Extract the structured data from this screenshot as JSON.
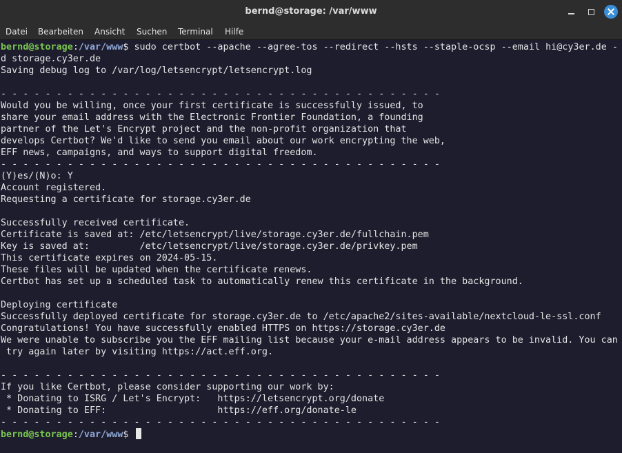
{
  "window": {
    "title": "bernd@storage: /var/www"
  },
  "menu": [
    "Datei",
    "Bearbeiten",
    "Ansicht",
    "Suchen",
    "Terminal",
    "Hilfe"
  ],
  "prompt": {
    "user_host": "bernd@storage",
    "colon": ":",
    "path": "/var/www",
    "dollar": "$ "
  },
  "command": "sudo certbot --apache --agree-tos --redirect --hsts --staple-ocsp --email hi@cy3er.de -",
  "output": [
    "d storage.cy3er.de",
    "Saving debug log to /var/log/letsencrypt/letsencrypt.log",
    "",
    "- - - - - - - - - - - - - - - - - - - - - - - - - - - - - - - - - - - - - - - -",
    "Would you be willing, once your first certificate is successfully issued, to",
    "share your email address with the Electronic Frontier Foundation, a founding",
    "partner of the Let's Encrypt project and the non-profit organization that",
    "develops Certbot? We'd like to send you email about our work encrypting the web,",
    "EFF news, campaigns, and ways to support digital freedom.",
    "- - - - - - - - - - - - - - - - - - - - - - - - - - - - - - - - - - - - - - - -",
    "(Y)es/(N)o: Y",
    "Account registered.",
    "Requesting a certificate for storage.cy3er.de",
    "",
    "Successfully received certificate.",
    "Certificate is saved at: /etc/letsencrypt/live/storage.cy3er.de/fullchain.pem",
    "Key is saved at:         /etc/letsencrypt/live/storage.cy3er.de/privkey.pem",
    "This certificate expires on 2024-05-15.",
    "These files will be updated when the certificate renews.",
    "Certbot has set up a scheduled task to automatically renew this certificate in the background.",
    "",
    "Deploying certificate",
    "Successfully deployed certificate for storage.cy3er.de to /etc/apache2/sites-available/nextcloud-le-ssl.conf",
    "Congratulations! You have successfully enabled HTTPS on https://storage.cy3er.de",
    "We were unable to subscribe you the EFF mailing list because your e-mail address appears to be invalid. You can",
    " try again later by visiting https://act.eff.org.",
    "",
    "- - - - - - - - - - - - - - - - - - - - - - - - - - - - - - - - - - - - - - - -",
    "If you like Certbot, please consider supporting our work by:",
    " * Donating to ISRG / Let's Encrypt:   https://letsencrypt.org/donate",
    " * Donating to EFF:                    https://eff.org/donate-le",
    "- - - - - - - - - - - - - - - - - - - - - - - - - - - - - - - - - - - - - - - -"
  ],
  "colors": {
    "background": "#1e1d2e",
    "text": "#e4e4e4",
    "prompt_user": "#7ac74f",
    "prompt_path": "#8fa8d6",
    "close_button": "#3a8fd8"
  }
}
